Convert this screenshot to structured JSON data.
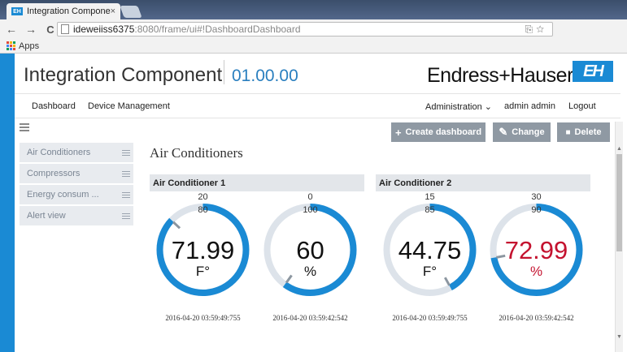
{
  "browser": {
    "tab_title": "Integration Component",
    "tab_close": "×",
    "favicon_text": "EH",
    "url_host": "ideweiiss6375",
    "url_rest": ":8080/frame/ui#!DashboardDashboard",
    "bookmarks_apps": "Apps",
    "back_glyph": "←",
    "forward_glyph": "→",
    "reload_glyph": "C",
    "omni_icons": "⎘☆"
  },
  "header": {
    "app_title": "Integration Component",
    "version": "01.00.00",
    "brand": "Endress+Hauser",
    "logo_text": "EH"
  },
  "menu": {
    "dashboard": "Dashboard",
    "device_management": "Device Management",
    "administration": "Administration ⌄",
    "user": "admin admin",
    "logout": "Logout"
  },
  "sidebar": {
    "items": [
      {
        "label": "Air Conditioners"
      },
      {
        "label": "Compressors"
      },
      {
        "label": "Energy consum ..."
      },
      {
        "label": "Alert view"
      }
    ]
  },
  "actions": {
    "create": {
      "label": "Create dashboard",
      "icon": "plus-icon",
      "glyph": "+"
    },
    "change": {
      "label": "Change",
      "icon": "pencil-icon",
      "glyph": "✎"
    },
    "delete": {
      "label": "Delete",
      "icon": "trash-icon",
      "glyph": "🗑"
    }
  },
  "page": {
    "title": "Air Conditioners"
  },
  "panels": [
    {
      "title": "Air Conditioner 1",
      "gauges": [
        {
          "min": "20",
          "max": "80",
          "value": "71.99",
          "unit": "F°",
          "timestamp": "2016-04-20 03:59:49:755",
          "fraction": 0.87,
          "alarm": false
        },
        {
          "min": "0",
          "max": "100",
          "value": "60",
          "unit": "%",
          "timestamp": "2016-04-20 03:59:42:542",
          "fraction": 0.6,
          "alarm": false
        }
      ]
    },
    {
      "title": "Air Conditioner 2",
      "gauges": [
        {
          "min": "15",
          "max": "85",
          "value": "44.75",
          "unit": "F°",
          "timestamp": "2016-04-20 03:59:49:755",
          "fraction": 0.42,
          "alarm": false
        },
        {
          "min": "30",
          "max": "90",
          "value": "72.99",
          "unit": "%",
          "timestamp": "2016-04-20 03:59:42:542",
          "fraction": 0.72,
          "alarm": true
        }
      ]
    }
  ],
  "colors": {
    "accent": "#1a8ad4",
    "alarm": "#c4122f",
    "track": "#dde3ea",
    "marker": "#8c96a0"
  }
}
